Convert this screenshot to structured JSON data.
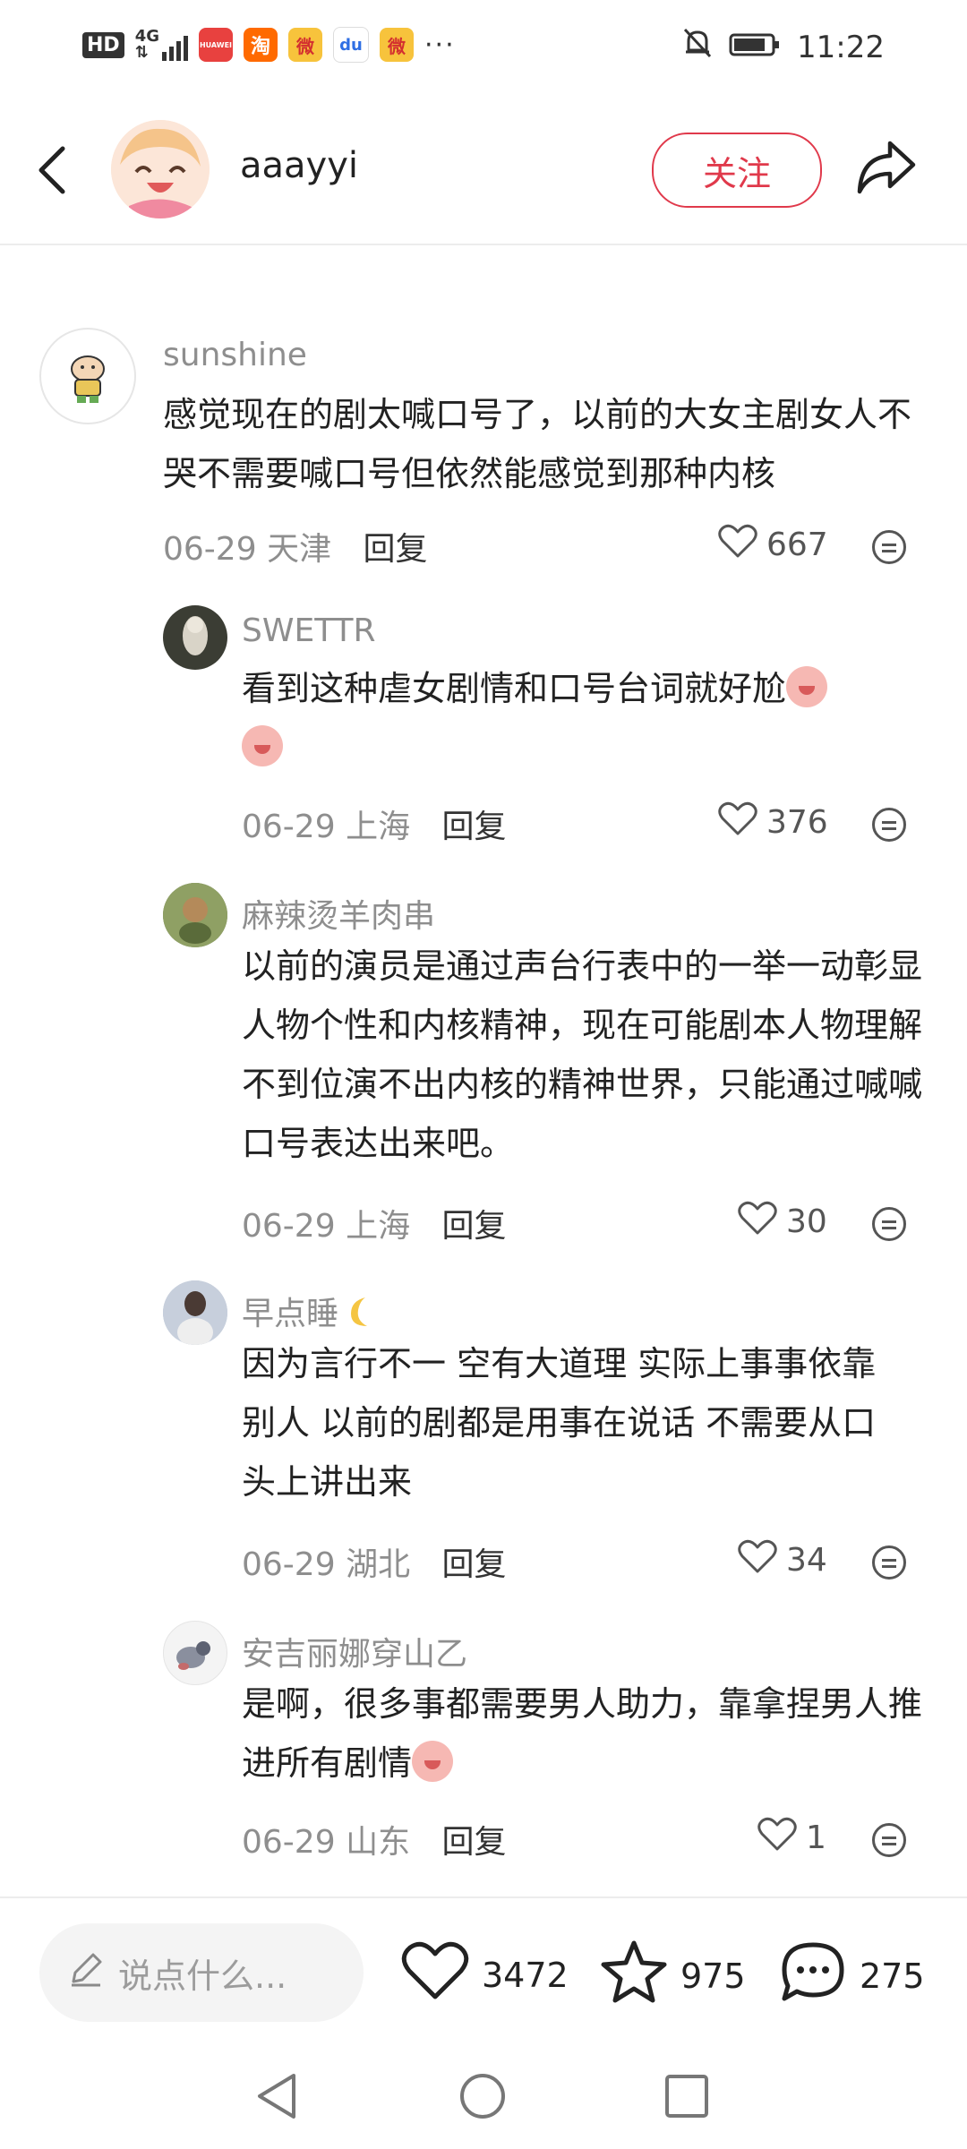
{
  "status_bar": {
    "hd": "HD",
    "network_top": "4G",
    "network_bottom": "⇅",
    "apps": [
      {
        "icon": "huawei-app-icon",
        "label": "HUAWEI",
        "color": "#e8413f"
      },
      {
        "icon": "taobao-icon",
        "label": "淘",
        "color": "#ff6a00"
      },
      {
        "icon": "weibo-icon",
        "label": "微",
        "color": "#f7c33c"
      },
      {
        "icon": "baidu-icon",
        "label": "du",
        "color": "#2f6fe4"
      },
      {
        "icon": "weibo-alt-icon",
        "label": "微",
        "color": "#f7c33c"
      }
    ],
    "more": "···",
    "time": "11:22"
  },
  "header": {
    "username": "aaayyi",
    "follow_label": "关注"
  },
  "comments": [
    {
      "name": "sunshine",
      "text": "感觉现在的剧太喊口号了，以前的大女主剧女人不哭不需要喊口号但依然能感觉到那种内核",
      "date": "06-29",
      "location": "天津",
      "reply": "回复",
      "likes": "667"
    },
    {
      "name": "SWETTR",
      "text": "看到这种虐女剧情和口号台词就好尬",
      "date": "06-29",
      "location": "上海",
      "reply": "回复",
      "likes": "376"
    },
    {
      "name": "麻辣烫羊肉串",
      "text": "以前的演员是通过声台行表中的一举一动彰显人物个性和内核精神，现在可能剧本人物理解不到位演不出内核的精神世界，只能通过喊喊口号表达出来吧。",
      "date": "06-29",
      "location": "上海",
      "reply": "回复",
      "likes": "30"
    },
    {
      "name": "早点睡",
      "text": "因为言行不一 空有大道理 实际上事事依靠别人 以前的剧都是用事在说话 不需要从口头上讲出来",
      "date": "06-29",
      "location": "湖北",
      "reply": "回复",
      "likes": "34"
    },
    {
      "name": "安吉丽娜穿山乙",
      "text": "是啊，很多事都需要男人助力，靠拿捏男人推进所有剧情",
      "date": "06-29",
      "location": "山东",
      "reply": "回复",
      "likes": "1"
    }
  ],
  "bottom_bar": {
    "input_placeholder": "说点什么...",
    "likes": "3472",
    "favorites": "975",
    "comments": "275"
  }
}
